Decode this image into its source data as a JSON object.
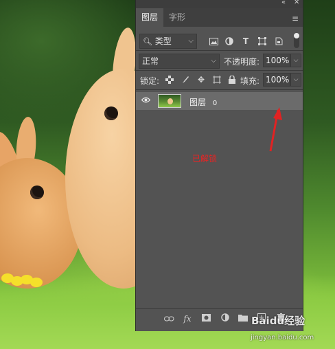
{
  "panel": {
    "tabs": [
      {
        "label": "图层",
        "active": true
      },
      {
        "label": "字形",
        "active": false
      }
    ],
    "filter": {
      "icon": "search-icon",
      "label": "类型"
    },
    "filter_icons": [
      "image-filter-icon",
      "adjustment-filter-icon",
      "text-filter-icon",
      "shape-filter-icon",
      "smart-object-filter-icon"
    ],
    "blend_mode": "正常",
    "opacity": {
      "label": "不透明度:",
      "value": "100%"
    },
    "lock": {
      "label": "锁定:"
    },
    "fill": {
      "label": "填充:",
      "value": "100%"
    },
    "layer": {
      "name": "图层",
      "index": "0",
      "visible": true
    }
  },
  "annotation": {
    "text": "已解锁",
    "color": "#e22222"
  },
  "watermark": {
    "text": "Baidu经验",
    "url": "jingyan.baidu.com"
  },
  "colors": {
    "panel_bg": "#535353",
    "tab_bar": "#3f3f3f",
    "selected_layer": "#6b6b6b"
  }
}
